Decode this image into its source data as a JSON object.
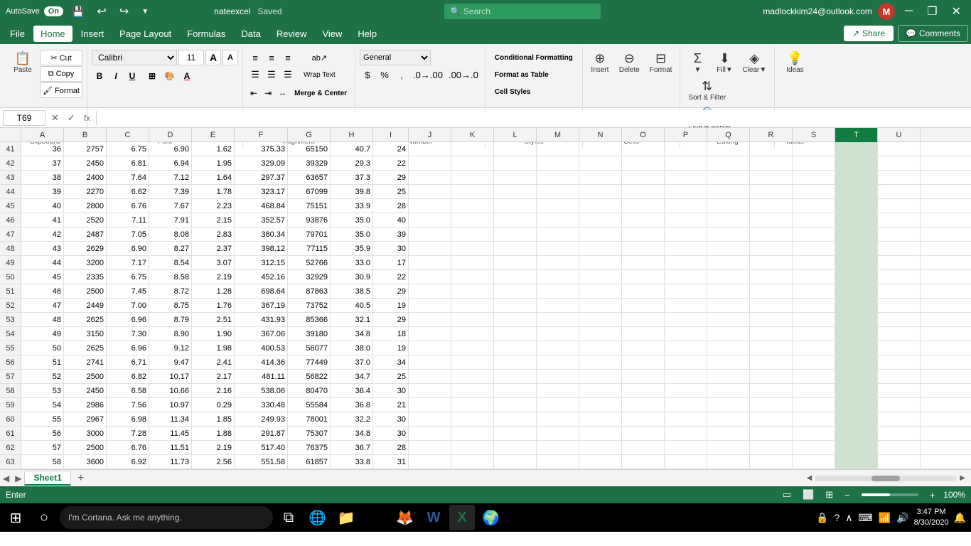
{
  "titlebar": {
    "autosave_label": "AutoSave",
    "autosave_state": "On",
    "filename": "nateexcel",
    "save_status": "Saved",
    "search_placeholder": "Search",
    "user_email": "madlockkim24@outlook.com",
    "share_label": "Share",
    "comments_label": "Comments",
    "minimize": "─",
    "restore": "❐",
    "close": "✕"
  },
  "menu": {
    "items": [
      "File",
      "Home",
      "Insert",
      "Page Layout",
      "Formulas",
      "Data",
      "Review",
      "View",
      "Help"
    ]
  },
  "ribbon": {
    "clipboard_label": "Clipboard",
    "font_label": "Font",
    "alignment_label": "Alignment",
    "number_label": "Number",
    "styles_label": "Styles",
    "cells_label": "Cells",
    "editing_label": "Editing",
    "ideas_label": "Ideas",
    "font_name": "Calibri",
    "font_size": "11",
    "wrap_text": "Wrap Text",
    "merge_center": "Merge & Center",
    "format_as_table": "Format as Table",
    "cell_styles": "Cell Styles",
    "insert_label": "Insert",
    "delete_label": "Delete",
    "format_label": "Format",
    "ideas_btn": "Ideas",
    "sort_filter": "Sort & Filter",
    "find_select": "Find & Select",
    "conditional_formatting": "Conditional Formatting",
    "number_format": "General",
    "select_label": "Select ~"
  },
  "formula_bar": {
    "cell_ref": "T69",
    "formula": ""
  },
  "columns": {
    "headers": [
      "A",
      "B",
      "C",
      "D",
      "E",
      "F",
      "G",
      "H",
      "I",
      "J",
      "K",
      "L",
      "M",
      "N",
      "O",
      "P",
      "Q",
      "R",
      "S",
      "T",
      "U"
    ],
    "widths": [
      60,
      60,
      60,
      60,
      60,
      75,
      60,
      60,
      50,
      60,
      60,
      60,
      60,
      60,
      60,
      60,
      60,
      60,
      60,
      60,
      60
    ]
  },
  "rows": [
    {
      "num": 41,
      "a": "36",
      "b": "2757",
      "c": "6.75",
      "d": "6.90",
      "e": "1.62",
      "f": "375.33",
      "g": "65150",
      "h": "40.7",
      "i": "24"
    },
    {
      "num": 42,
      "a": "37",
      "b": "2450",
      "c": "6.81",
      "d": "6.94",
      "e": "1.95",
      "f": "329.09",
      "g": "39329",
      "h": "29.3",
      "i": "22"
    },
    {
      "num": 43,
      "a": "38",
      "b": "2400",
      "c": "7.64",
      "d": "7.12",
      "e": "1.64",
      "f": "297.37",
      "g": "63657",
      "h": "37.3",
      "i": "29"
    },
    {
      "num": 44,
      "a": "39",
      "b": "2270",
      "c": "6.62",
      "d": "7.39",
      "e": "1.78",
      "f": "323.17",
      "g": "67099",
      "h": "39.8",
      "i": "25"
    },
    {
      "num": 45,
      "a": "40",
      "b": "2800",
      "c": "6.76",
      "d": "7.67",
      "e": "2.23",
      "f": "468.84",
      "g": "75151",
      "h": "33.9",
      "i": "28"
    },
    {
      "num": 46,
      "a": "41",
      "b": "2520",
      "c": "7.11",
      "d": "7.91",
      "e": "2.15",
      "f": "352.57",
      "g": "93876",
      "h": "35.0",
      "i": "40"
    },
    {
      "num": 47,
      "a": "42",
      "b": "2487",
      "c": "7.05",
      "d": "8.08",
      "e": "2.83",
      "f": "380.34",
      "g": "79701",
      "h": "35.0",
      "i": "39"
    },
    {
      "num": 48,
      "a": "43",
      "b": "2629",
      "c": "6.90",
      "d": "8.27",
      "e": "2.37",
      "f": "398.12",
      "g": "77115",
      "h": "35.9",
      "i": "30"
    },
    {
      "num": 49,
      "a": "44",
      "b": "3200",
      "c": "7.17",
      "d": "8.54",
      "e": "3.07",
      "f": "312.15",
      "g": "52766",
      "h": "33.0",
      "i": "17"
    },
    {
      "num": 50,
      "a": "45",
      "b": "2335",
      "c": "6.75",
      "d": "8.58",
      "e": "2.19",
      "f": "452.16",
      "g": "32929",
      "h": "30.9",
      "i": "22"
    },
    {
      "num": 51,
      "a": "46",
      "b": "2500",
      "c": "7.45",
      "d": "8.72",
      "e": "1.28",
      "f": "698.64",
      "g": "87863",
      "h": "38.5",
      "i": "29"
    },
    {
      "num": 52,
      "a": "47",
      "b": "2449",
      "c": "7.00",
      "d": "8.75",
      "e": "1.76",
      "f": "367.19",
      "g": "73752",
      "h": "40.5",
      "i": "19"
    },
    {
      "num": 53,
      "a": "48",
      "b": "2625",
      "c": "6.96",
      "d": "8.79",
      "e": "2.51",
      "f": "431.93",
      "g": "85366",
      "h": "32.1",
      "i": "29"
    },
    {
      "num": 54,
      "a": "49",
      "b": "3150",
      "c": "7.30",
      "d": "8.90",
      "e": "1.90",
      "f": "367.06",
      "g": "39180",
      "h": "34.8",
      "i": "18"
    },
    {
      "num": 55,
      "a": "50",
      "b": "2625",
      "c": "6.96",
      "d": "9.12",
      "e": "1.98",
      "f": "400.53",
      "g": "56077",
      "h": "38.0",
      "i": "19"
    },
    {
      "num": 56,
      "a": "51",
      "b": "2741",
      "c": "6.71",
      "d": "9.47",
      "e": "2.41",
      "f": "414.36",
      "g": "77449",
      "h": "37.0",
      "i": "34"
    },
    {
      "num": 57,
      "a": "52",
      "b": "2500",
      "c": "6.82",
      "d": "10.17",
      "e": "2.17",
      "f": "481.11",
      "g": "56822",
      "h": "34.7",
      "i": "25"
    },
    {
      "num": 58,
      "a": "53",
      "b": "2450",
      "c": "6.58",
      "d": "10.66",
      "e": "2.16",
      "f": "538.06",
      "g": "80470",
      "h": "36.4",
      "i": "30"
    },
    {
      "num": 59,
      "a": "54",
      "b": "2986",
      "c": "7.56",
      "d": "10.97",
      "e": "0.29",
      "f": "330.48",
      "g": "55584",
      "h": "36.8",
      "i": "21"
    },
    {
      "num": 60,
      "a": "55",
      "b": "2967",
      "c": "6.98",
      "d": "11.34",
      "e": "1.85",
      "f": "249.93",
      "g": "78001",
      "h": "32.2",
      "i": "30"
    },
    {
      "num": 61,
      "a": "56",
      "b": "3000",
      "c": "7.28",
      "d": "11.45",
      "e": "1.88",
      "f": "291.87",
      "g": "75307",
      "h": "34.8",
      "i": "30"
    },
    {
      "num": 62,
      "a": "57",
      "b": "2500",
      "c": "6.76",
      "d": "11.51",
      "e": "2.19",
      "f": "517.40",
      "g": "76375",
      "h": "36.7",
      "i": "28"
    },
    {
      "num": 63,
      "a": "58",
      "b": "3600",
      "c": "6.92",
      "d": "11.73",
      "e": "2.56",
      "f": "551.58",
      "g": "61857",
      "h": "33.8",
      "i": "31"
    }
  ],
  "sheet_tabs": {
    "active": "Sheet1",
    "tabs": [
      "Sheet1"
    ]
  },
  "status_bar": {
    "mode": "Enter",
    "zoom": "100%"
  },
  "taskbar": {
    "search_placeholder": "I'm Cortana. Ask me anything.",
    "time": "3:47 PM",
    "date": "8/30/2020"
  }
}
